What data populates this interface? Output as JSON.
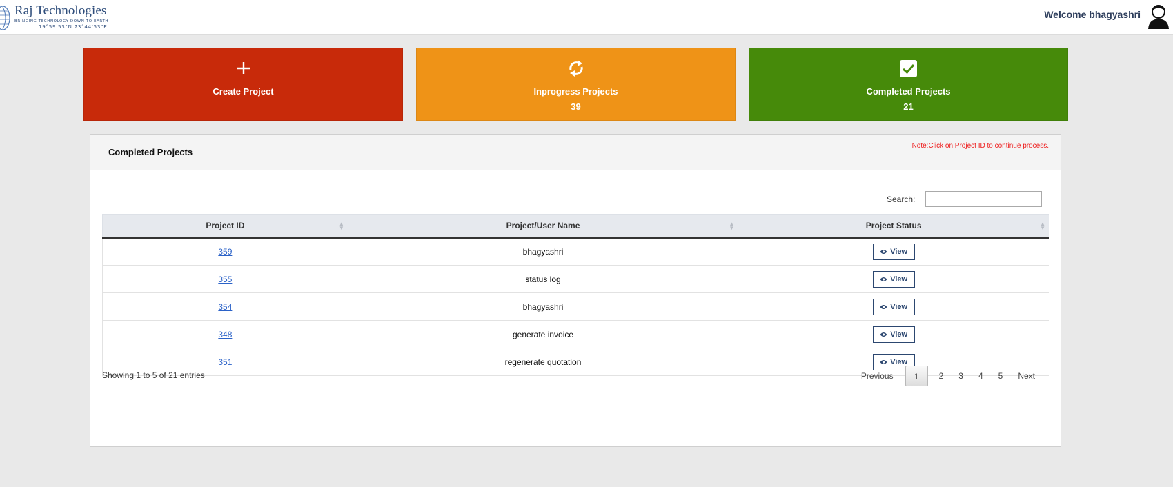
{
  "brand": {
    "name": "Raj Technologies",
    "tagline": "BRINGING TECHNOLOGY DOWN TO EARTH",
    "coords": "19°59'53\"N  73°44'53\"E"
  },
  "header": {
    "welcome": "Welcome bhagyashri"
  },
  "tiles": {
    "create": {
      "label": "Create Project",
      "color": "#c82a0a"
    },
    "inprogress": {
      "label": "Inprogress Projects",
      "count": "39",
      "color": "#ef9317"
    },
    "completed": {
      "label": "Completed Projects",
      "count": "21",
      "color": "#468a0a"
    }
  },
  "panel": {
    "title": "Completed Projects",
    "note": "Note:Click on Project ID to continue process.",
    "search_label": "Search:",
    "search_value": ""
  },
  "table": {
    "headers": [
      "Project ID",
      "Project/User Name",
      "Project Status"
    ],
    "rows": [
      {
        "id": "359",
        "name": "bhagyashri",
        "status": "View"
      },
      {
        "id": "355",
        "name": "status log",
        "status": "View"
      },
      {
        "id": "354",
        "name": "bhagyashri",
        "status": "View"
      },
      {
        "id": "348",
        "name": "generate invoice",
        "status": "View"
      },
      {
        "id": "351",
        "name": "regenerate quotation",
        "status": "View"
      }
    ]
  },
  "footer": {
    "info": "Showing 1 to 5 of 21 entries",
    "prev": "Previous",
    "next": "Next",
    "pages": [
      "1",
      "2",
      "3",
      "4",
      "5"
    ],
    "current_page": "1"
  },
  "icons": {
    "create": "plus-icon",
    "inprogress": "refresh-icon",
    "completed": "check-square-icon",
    "view": "eye-icon",
    "sort": "sort-icon",
    "avatar": "user-avatar-icon"
  }
}
